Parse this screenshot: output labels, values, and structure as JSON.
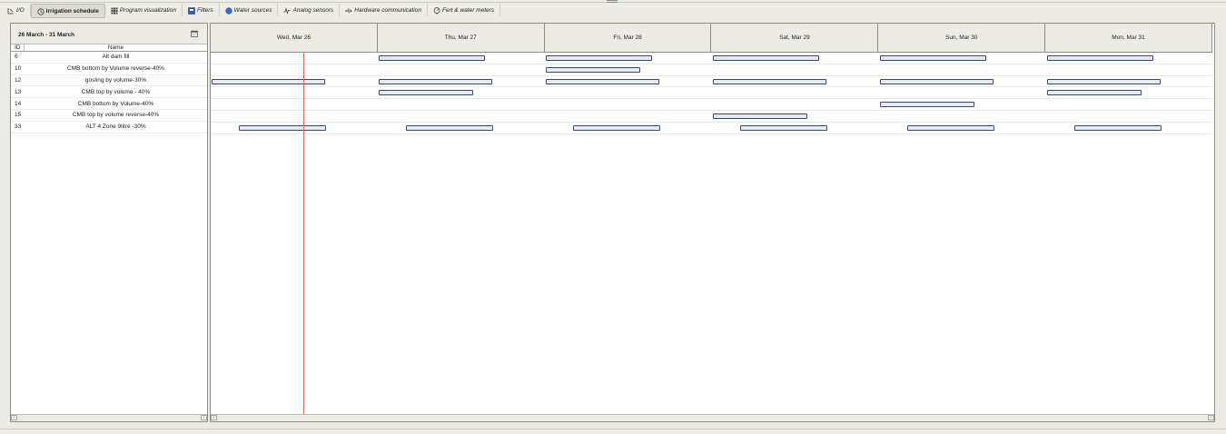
{
  "tabs": [
    {
      "label": "I/O",
      "icon": "io-icon",
      "active": false
    },
    {
      "label": "Irrigation schedule",
      "icon": "clock-icon",
      "active": true
    },
    {
      "label": "Program visualization",
      "icon": "grid-icon",
      "active": false
    },
    {
      "label": "Filters",
      "icon": "filter-icon",
      "active": false
    },
    {
      "label": "Water sources",
      "icon": "water-drop-icon",
      "active": false
    },
    {
      "label": "Analog sensors",
      "icon": "sensor-wave-icon",
      "active": false
    },
    {
      "label": "Hardware communication",
      "icon": "usb-icon",
      "active": false
    },
    {
      "label": "Fert & water meters",
      "icon": "meter-icon",
      "active": false
    }
  ],
  "schedule": {
    "date_range": "26 March - 31 March",
    "col_id": "ID",
    "col_name": "Name",
    "days": [
      "Wed, Mar 26",
      "Thu, Mar 27",
      "Fri, Mar 28",
      "Sat, Mar 29",
      "Sun, Mar 30",
      "Mon, Mar 31"
    ],
    "now_hours": 2.11,
    "programs": [
      {
        "id": "6",
        "name": "Alt dam fill",
        "runs": [
          [
            1,
            0.0,
            15.3
          ],
          [
            2,
            0.0,
            15.3
          ],
          [
            3,
            0.0,
            15.3
          ],
          [
            4,
            0.0,
            15.3
          ],
          [
            5,
            0.0,
            15.3
          ]
        ]
      },
      {
        "id": "10",
        "name": "CMB bottom by Volume  reverse-40%",
        "runs": [
          [
            2,
            0.0,
            13.6
          ]
        ]
      },
      {
        "id": "12",
        "name": "gosling by volume-30%",
        "runs": [
          [
            0,
            0.0,
            16.3
          ],
          [
            1,
            0.0,
            16.3
          ],
          [
            2,
            0.0,
            16.3
          ],
          [
            3,
            0.0,
            16.3
          ],
          [
            4,
            0.0,
            16.3
          ],
          [
            5,
            0.0,
            16.3
          ]
        ]
      },
      {
        "id": "13",
        "name": "CMB top by volume - 40%",
        "runs": [
          [
            1,
            0.0,
            13.6
          ],
          [
            5,
            0.0,
            13.6
          ]
        ]
      },
      {
        "id": "14",
        "name": "CMB bottom by Volume-40%",
        "runs": [
          [
            4,
            0.0,
            13.6
          ]
        ]
      },
      {
        "id": "15",
        "name": "CMB top by volume reverse-40%",
        "runs": [
          [
            3,
            0.0,
            13.6
          ]
        ]
      },
      {
        "id": "33",
        "name": "ALT 4 Zone 9litre -30%",
        "runs": [
          [
            0,
            3.9,
            16.5
          ],
          [
            1,
            3.9,
            16.5
          ],
          [
            2,
            3.9,
            16.5
          ],
          [
            3,
            3.9,
            16.5
          ],
          [
            4,
            3.9,
            16.5
          ],
          [
            5,
            3.9,
            16.5
          ]
        ]
      }
    ]
  }
}
